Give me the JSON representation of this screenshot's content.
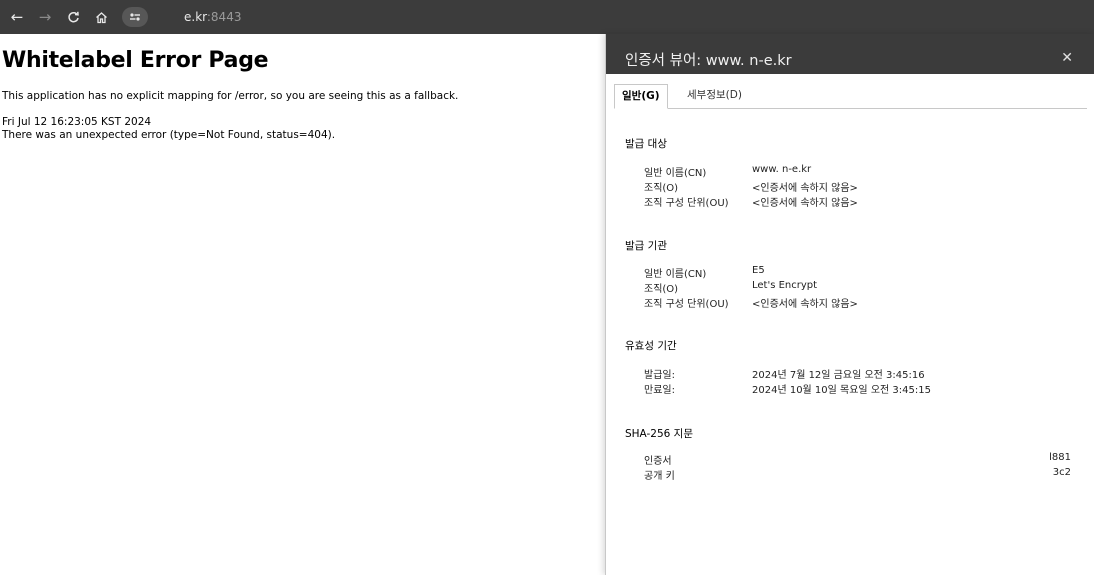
{
  "browser": {
    "url_host": "e.kr",
    "url_port": ":8443"
  },
  "page": {
    "title": "Whitelabel Error Page",
    "message": "This application has no explicit mapping for /error, so you are seeing this as a fallback.",
    "timestamp": "Fri Jul 12 16:23:05 KST 2024",
    "error_line": "There was an unexpected error (type=Not Found, status=404)."
  },
  "dialog": {
    "title": "인증서 뷰어: www.        n-e.kr",
    "close": "✕",
    "tabs": [
      "일반(G)",
      "세부정보(D)"
    ],
    "issued_to": {
      "heading": "발급 대상",
      "rows": [
        {
          "label": "일반 이름(CN)",
          "value": "www.        n-e.kr"
        },
        {
          "label": "조직(O)",
          "value": "<인증서에 속하지 않음>"
        },
        {
          "label": "조직 구성 단위(OU)",
          "value": "<인증서에 속하지 않음>"
        }
      ]
    },
    "issued_by": {
      "heading": "발급 기관",
      "rows": [
        {
          "label": "일반 이름(CN)",
          "value": "E5"
        },
        {
          "label": "조직(O)",
          "value": "Let's Encrypt"
        },
        {
          "label": "조직 구성 단위(OU)",
          "value": "<인증서에 속하지 않음>"
        }
      ]
    },
    "validity": {
      "heading": "유효성 기간",
      "rows": [
        {
          "label": "발급일:",
          "value": "2024년 7월 12일 금요일 오전 3:45:16"
        },
        {
          "label": "만료일:",
          "value": "2024년 10월 10일 목요일 오전 3:45:15"
        }
      ]
    },
    "fingerprint": {
      "heading": "SHA-256 지문",
      "rows": [
        {
          "label": "인증서",
          "value": "l881"
        },
        {
          "label": "공개 키",
          "value": "3c2"
        }
      ]
    }
  }
}
